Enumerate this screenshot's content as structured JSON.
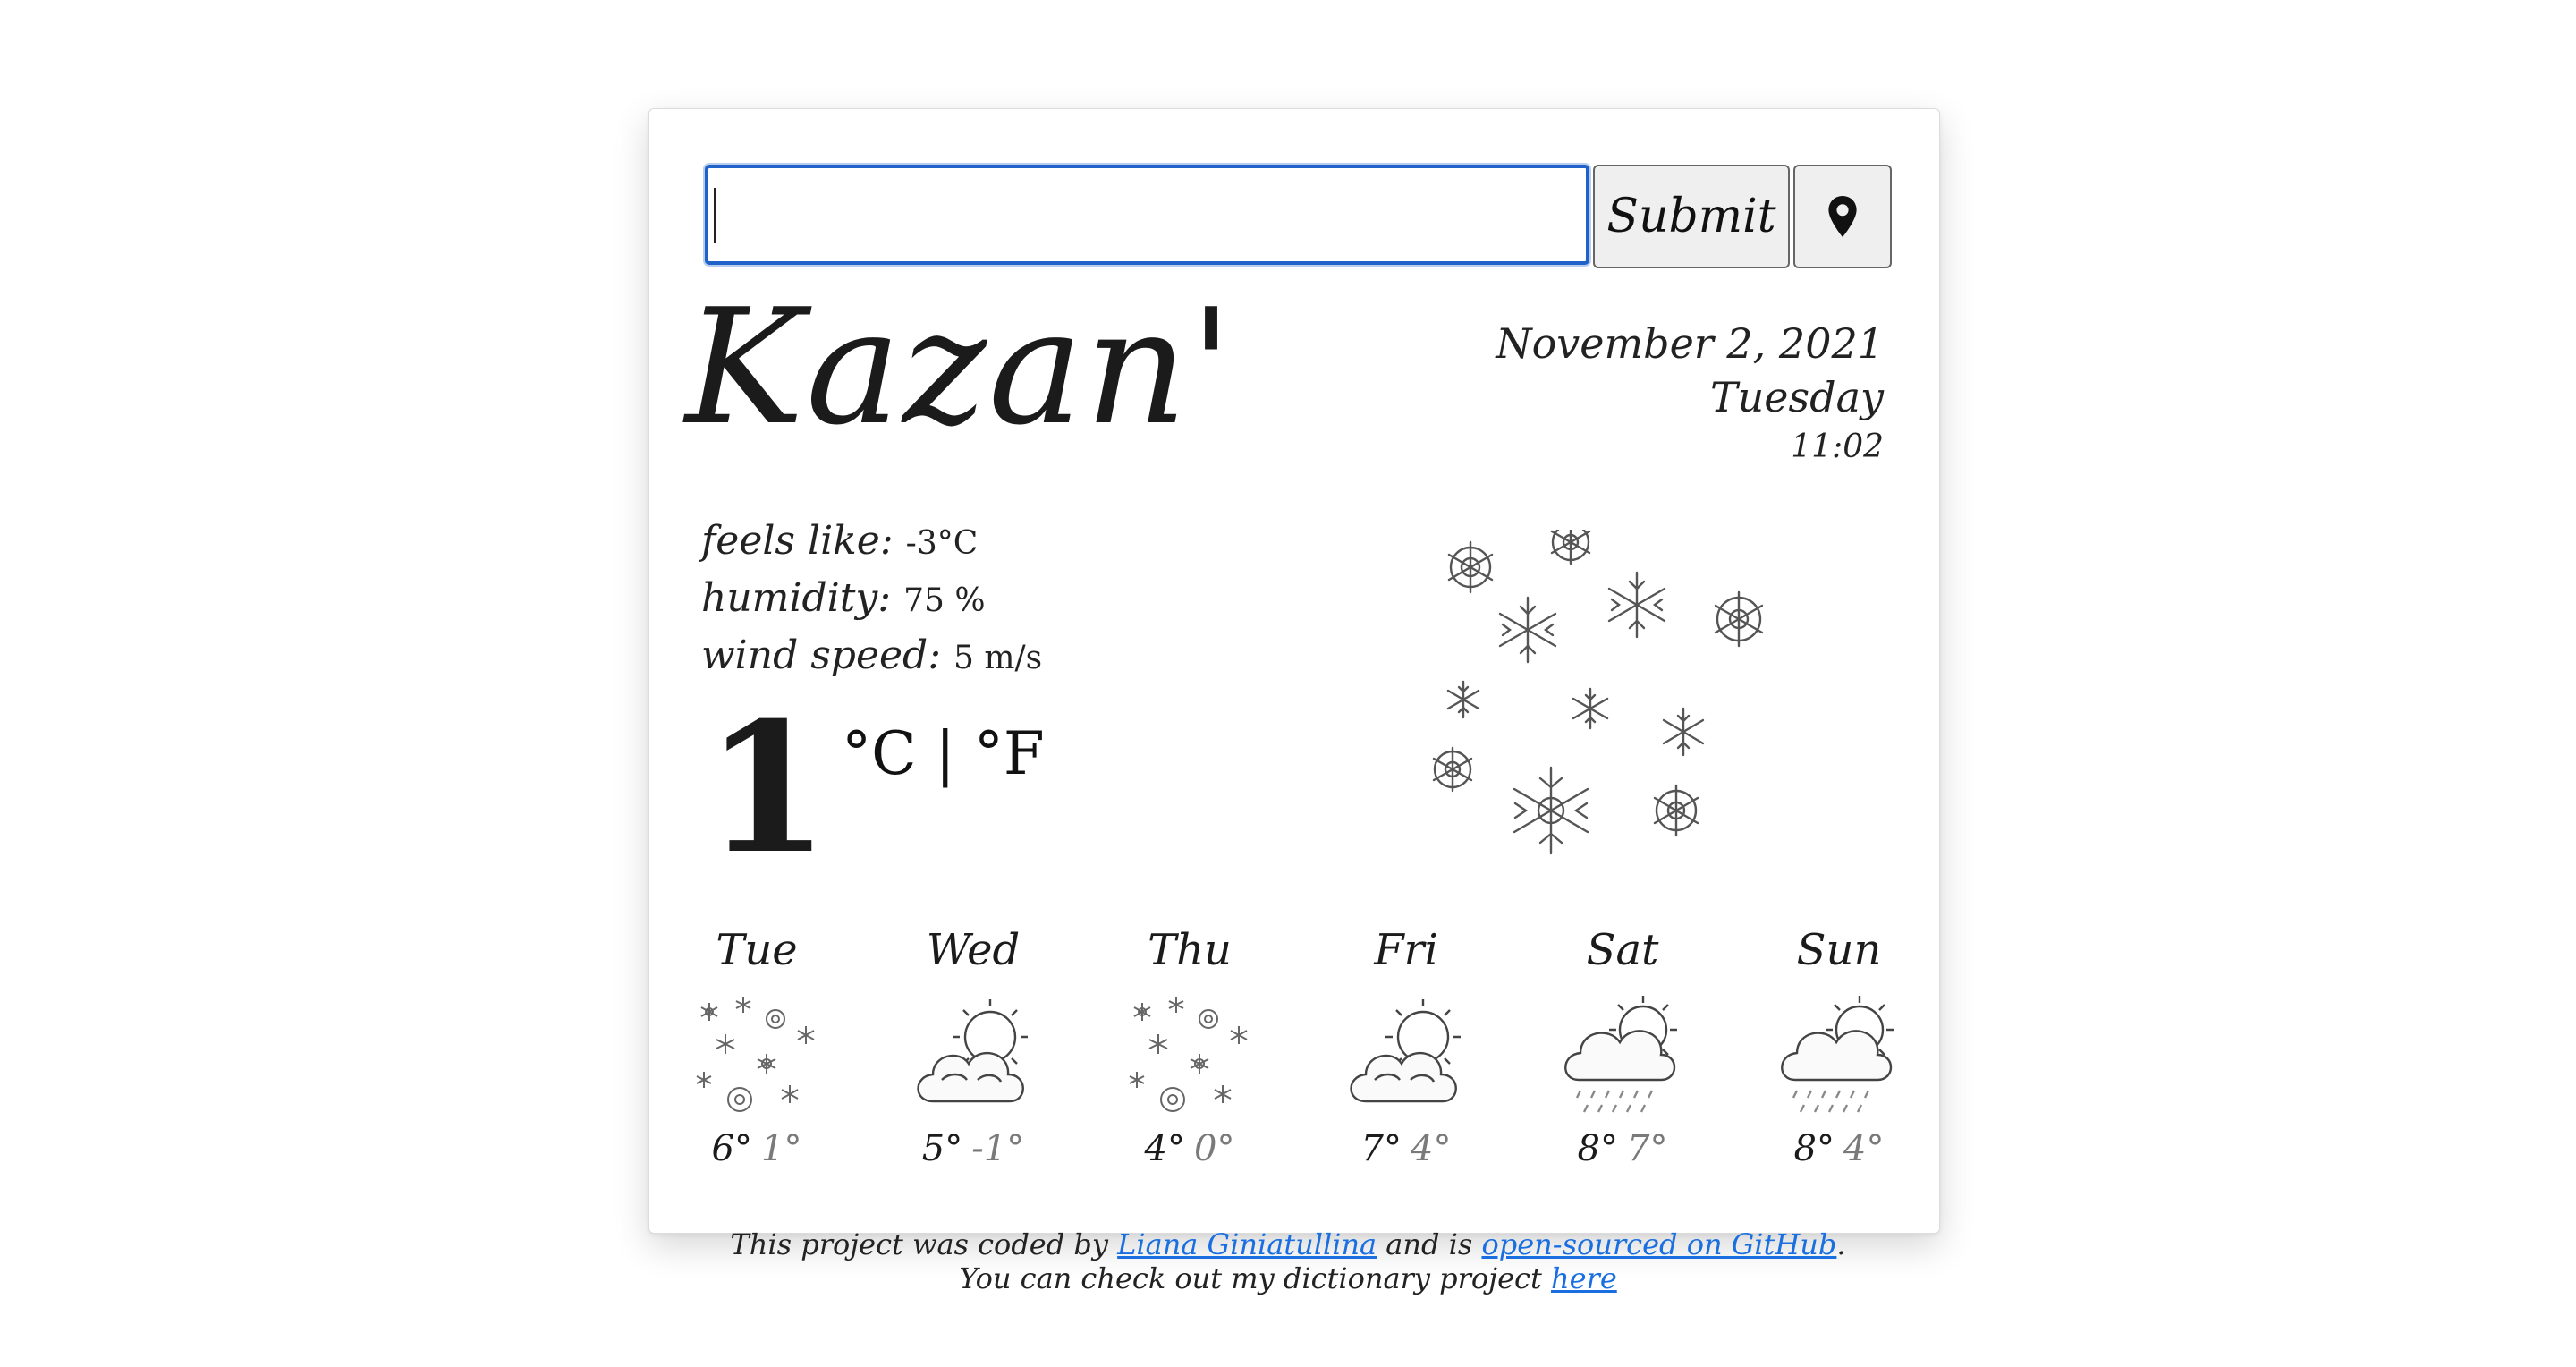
{
  "search": {
    "value": "",
    "placeholder": "",
    "submit_label": "Submit",
    "location_icon": "map-pin-icon"
  },
  "city": "Kazan'",
  "datetime": {
    "date": "November 2, 2021",
    "day": "Tuesday",
    "time": "11:02"
  },
  "details": {
    "feels_label": "feels like:",
    "feels_value": "-3°C",
    "humidity_label": "humidity:",
    "humidity_value": "75 %",
    "wind_label": "wind speed:",
    "wind_value": "5 m/s"
  },
  "current": {
    "temperature": "1",
    "unit_c": "°C",
    "separator": "|",
    "unit_f": "°F",
    "icon": "snowflakes-icon"
  },
  "forecast": [
    {
      "day": "Tue",
      "max": "6°",
      "min": "1°",
      "icon": "snow-icon"
    },
    {
      "day": "Wed",
      "max": "5°",
      "min": "-1°",
      "icon": "partly-cloudy-icon"
    },
    {
      "day": "Thu",
      "max": "4°",
      "min": "0°",
      "icon": "snow-icon"
    },
    {
      "day": "Fri",
      "max": "7°",
      "min": "4°",
      "icon": "partly-cloudy-icon"
    },
    {
      "day": "Sat",
      "max": "8°",
      "min": "7°",
      "icon": "rain-sun-icon"
    },
    {
      "day": "Sun",
      "max": "8°",
      "min": "4°",
      "icon": "rain-sun-icon"
    }
  ],
  "footer": {
    "line1_prefix": "This project was coded by",
    "author_link": "Liana Giniatullina",
    "line1_middle": "and is",
    "github_link": "open-sourced on GitHub",
    "line1_suffix": ".",
    "line2_prefix": "You can check out my dictionary project",
    "here_link": "here"
  },
  "colors": {
    "input_border": "#1f63c9",
    "link": "#1a6fe0",
    "min_temp": "#7a7a7a"
  }
}
